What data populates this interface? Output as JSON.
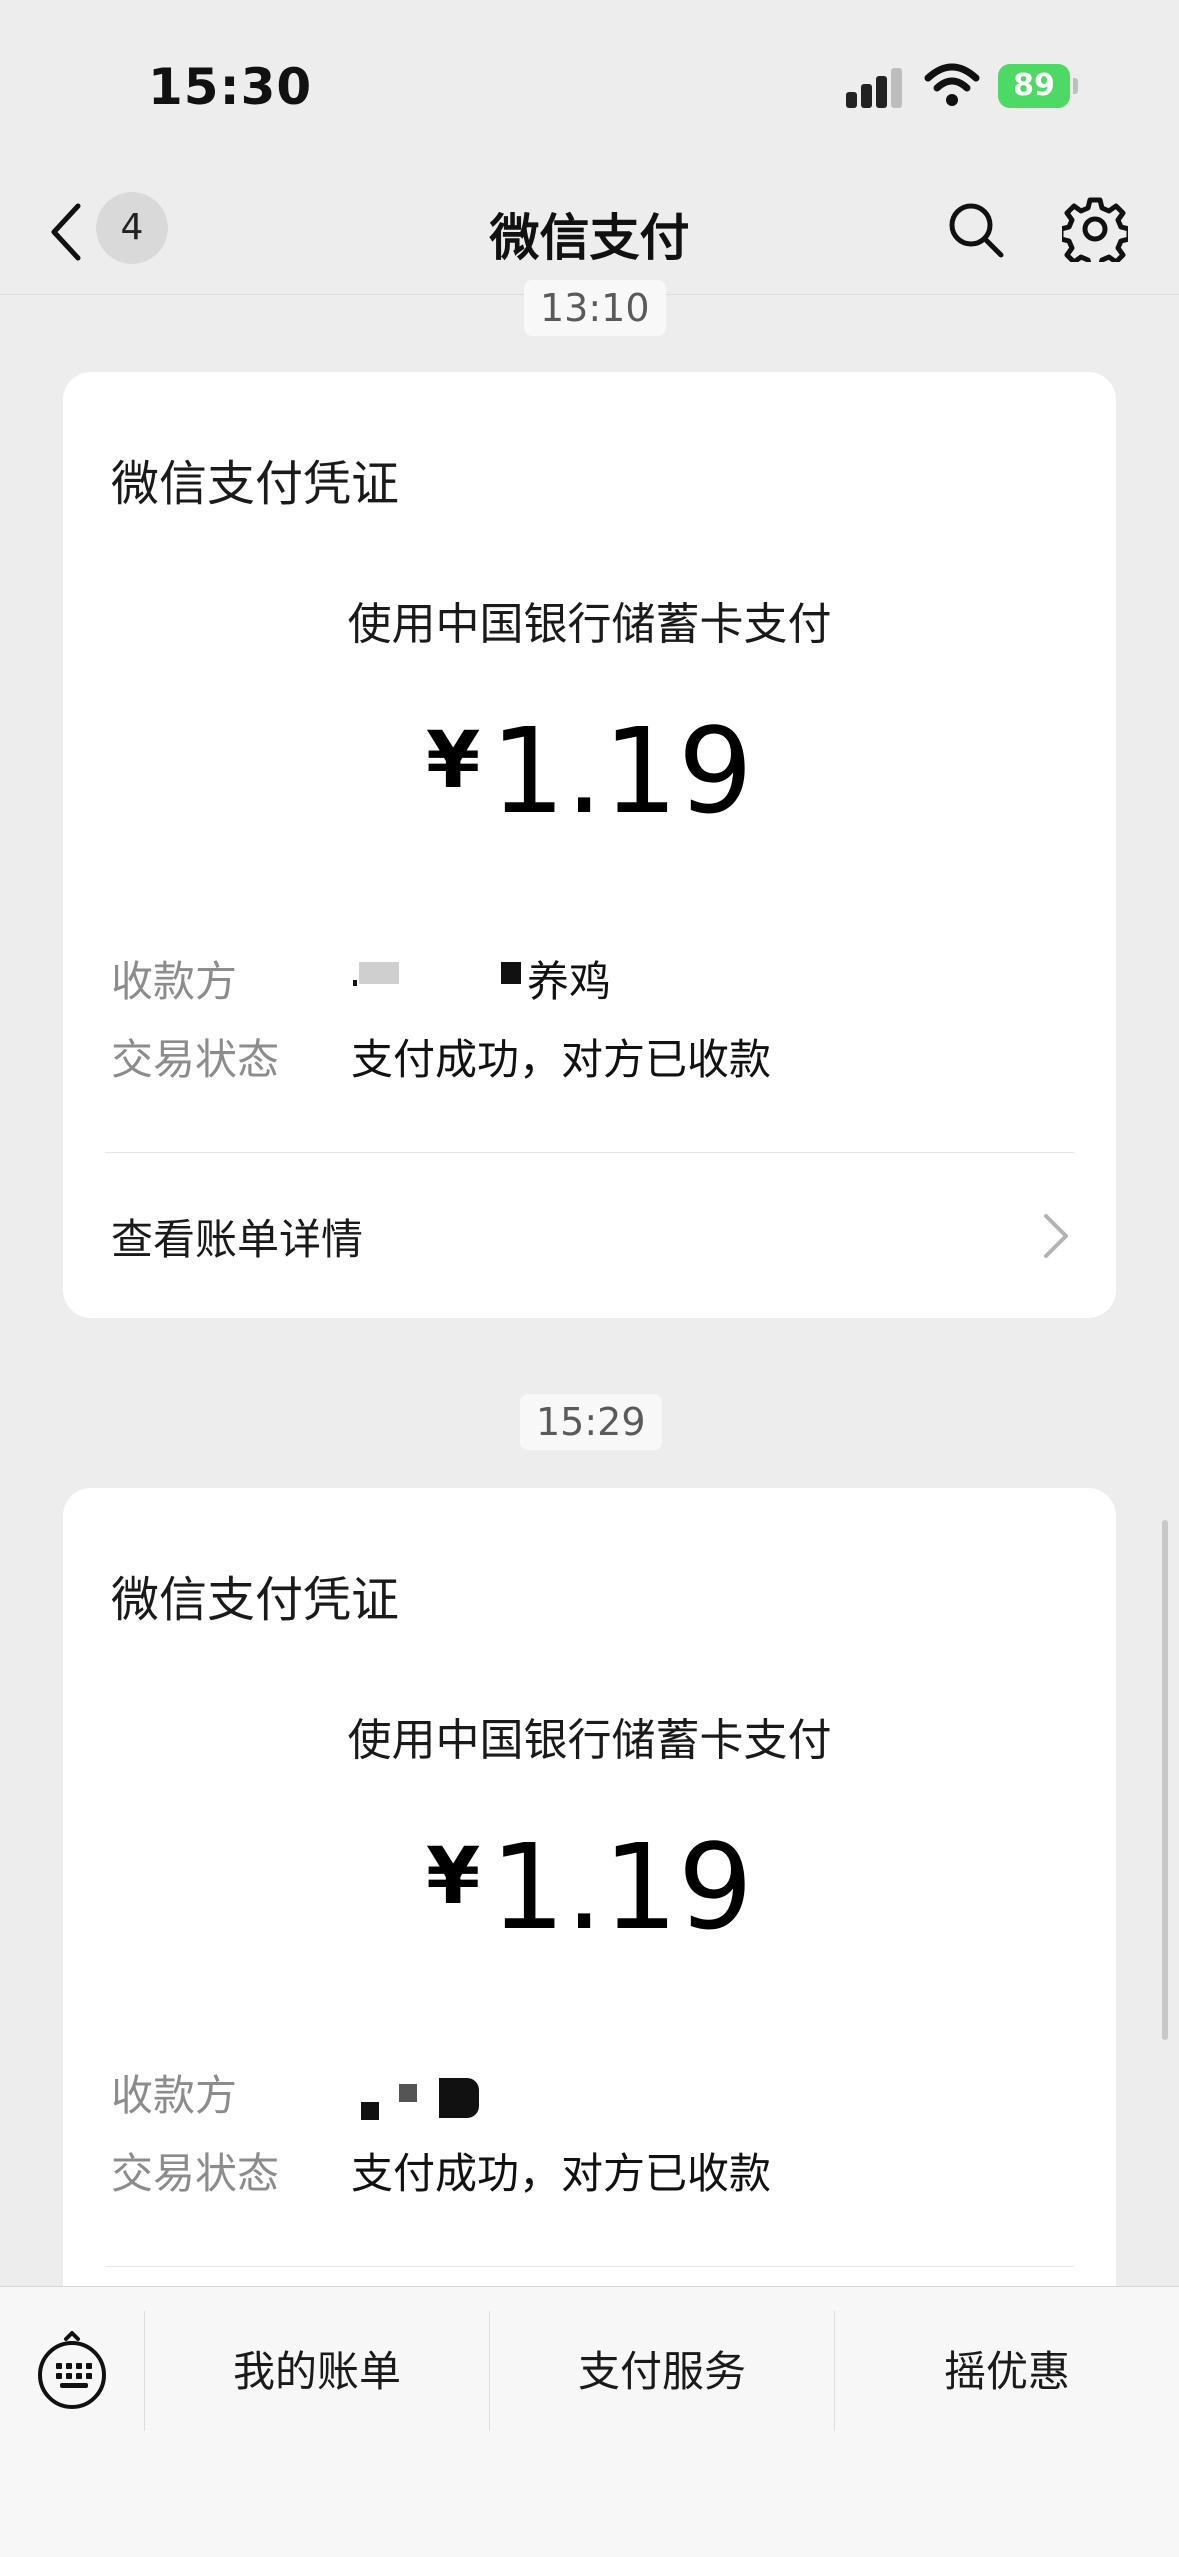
{
  "status_bar": {
    "time": "15:30",
    "battery": "89"
  },
  "nav": {
    "badge_count": "4",
    "title": "微信支付"
  },
  "messages": [
    {
      "time": "13:10",
      "title": "微信支付凭证",
      "payment_method": "使用中国银行储蓄卡支付",
      "currency_symbol": "¥",
      "amount": "1.19",
      "payee_label": "收款方",
      "payee_value": "养鸡",
      "status_label": "交易状态",
      "status_value": "支付成功，对方已收款",
      "detail_link": "查看账单详情"
    },
    {
      "time": "15:29",
      "title": "微信支付凭证",
      "payment_method": "使用中国银行储蓄卡支付",
      "currency_symbol": "¥",
      "amount": "1.19",
      "payee_label": "收款方",
      "status_label": "交易状态",
      "status_value": "支付成功，对方已收款"
    }
  ],
  "bottom_menu": [
    {
      "label": "我的账单"
    },
    {
      "label": "支付服务"
    },
    {
      "label": "摇优惠"
    }
  ],
  "colors": {
    "background": "#ededed",
    "card": "#ffffff",
    "battery": "#4cd964",
    "muted_text": "#8c8c8c"
  },
  "icons": [
    "signal-icon",
    "wifi-icon",
    "battery-icon",
    "back-chevron-icon",
    "search-icon",
    "gear-icon",
    "chevron-right-icon",
    "keyboard-icon"
  ]
}
